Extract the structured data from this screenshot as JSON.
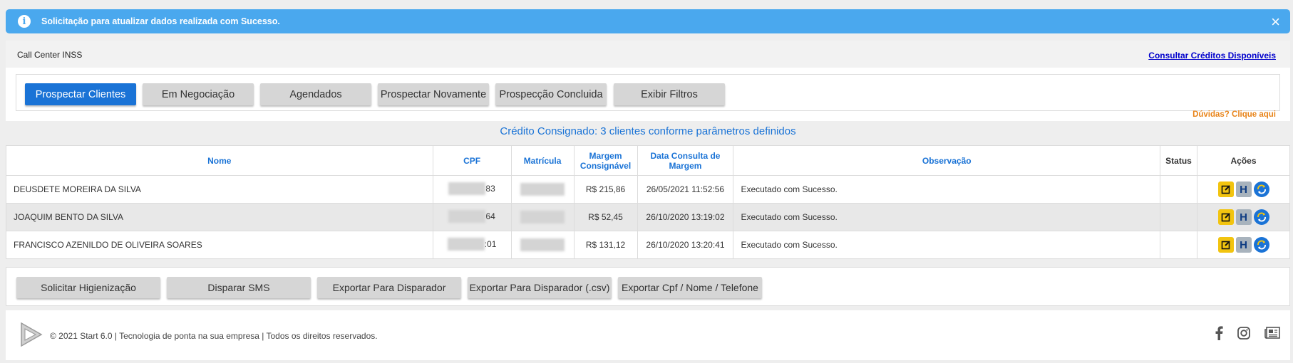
{
  "alert": {
    "message": "Solicitação para atualizar dados realizada com Sucesso.",
    "close_glyph": "×",
    "info_glyph": "i"
  },
  "header": {
    "title": "Call Center INSS",
    "link": "Consultar Créditos Disponíveis"
  },
  "tabs": [
    {
      "label": "Prospectar Clientes",
      "active": true
    },
    {
      "label": "Em Negociação"
    },
    {
      "label": "Agendados"
    },
    {
      "label": "Prospectar Novamente"
    },
    {
      "label": "Prospecção Concluida"
    },
    {
      "label": "Exibir Filtros"
    }
  ],
  "help_link": "Dúvidas? Clique aqui",
  "subtitle": "Crédito Consignado: 3 clientes conforme parâmetros definidos",
  "table": {
    "headers": [
      "Nome",
      "CPF",
      "Matrícula",
      "Margem Consignável",
      "Data Consulta de Margem",
      "Observação",
      "Status",
      "Ações"
    ],
    "rows": [
      {
        "nome": "DEUSDETE MOREIRA DA SILVA",
        "cpf_suffix": "83",
        "margem": "R$ 215,86",
        "data": "26/05/2021 11:52:56",
        "obs": "Executado com Sucesso.",
        "status": ""
      },
      {
        "nome": "JOAQUIM BENTO DA SILVA",
        "cpf_suffix": "64",
        "margem": "R$ 52,45",
        "data": "26/10/2020 13:19:02",
        "obs": "Executado com Sucesso.",
        "status": ""
      },
      {
        "nome": "FRANCISCO AZENILDO DE OLIVEIRA SOARES",
        "cpf_suffix": ":01",
        "margem": "R$ 131,12",
        "data": "26/10/2020 13:20:41",
        "obs": "Executado com Sucesso.",
        "status": ""
      }
    ]
  },
  "bottom_buttons": [
    "Solicitar Higienização",
    "Disparar SMS",
    "Exportar Para Disparador",
    "Exportar Para Disparador (.csv)",
    "Exportar Cpf / Nome / Telefone"
  ],
  "footer": {
    "copyright": "© 2021 Start 6.0 | Tecnologia de ponta na sua empresa | Todos os direitos reservados.",
    "social_icons": [
      "facebook-icon",
      "instagram-icon",
      "news-icon"
    ]
  },
  "colors": {
    "accent": "#1a73d6",
    "alert": "#4aa8ee",
    "help": "#e8841a",
    "edit": "#f2c40f"
  }
}
